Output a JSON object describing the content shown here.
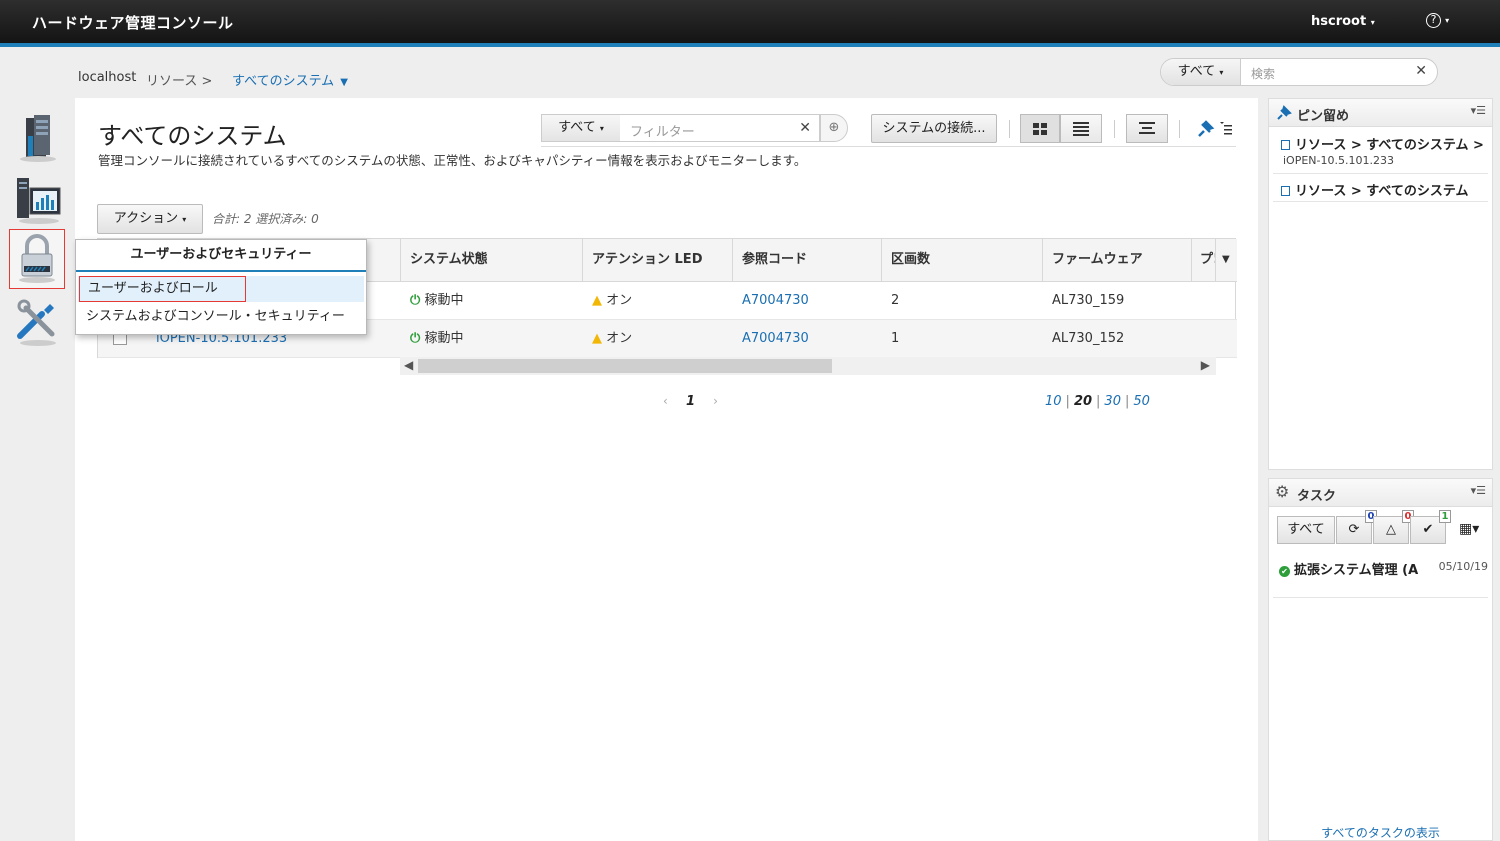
{
  "app": {
    "title": "ハードウェア管理コンソール",
    "user": "hscroot",
    "help": "?"
  },
  "breadcrumb": {
    "host": "localhost",
    "resources": "リソース >",
    "current": "すべてのシステム"
  },
  "global_search": {
    "scope": "すべて",
    "placeholder": "検索"
  },
  "page": {
    "title": "すべてのシステム",
    "description": "管理コンソールに接続されているすべてのシステムの状態、正常性、およびキャパシティー情報を表示およびモニターします。",
    "filter_scope": "すべて",
    "filter_placeholder": "フィルター",
    "connect_button": "システムの接続...",
    "actions_button": "アクション",
    "summary": "合計: 2 選択済み: 0"
  },
  "table": {
    "columns": [
      "システム状態",
      "アテンション LED",
      "参照コード",
      "区画数",
      "ファームウェア",
      "プ!"
    ],
    "rows": [
      {
        "name": "",
        "status": "稼動中",
        "led": "オン",
        "refcode": "A7004730",
        "partitions": "2",
        "firmware": "AL730_159"
      },
      {
        "name": "iOPEN-10.5.101.233",
        "status": "稼動中",
        "led": "オン",
        "refcode": "A7004730",
        "partitions": "1",
        "firmware": "AL730_152"
      }
    ]
  },
  "pager": {
    "prev": "‹",
    "page": "1",
    "next": "›",
    "sizes": [
      "10",
      "20",
      "30",
      "50"
    ],
    "current_size": "20"
  },
  "menu": {
    "header": "ユーザーおよびセキュリティー",
    "items": [
      "ユーザーおよびロール",
      "システムおよびコンソール・セキュリティー"
    ]
  },
  "pins": {
    "title": "ピン留め",
    "items": [
      {
        "label": "リソース > すべてのシステム > i",
        "sub": "iOPEN-10.5.101.233"
      },
      {
        "label": "リソース > すべてのシステム",
        "sub": ""
      }
    ]
  },
  "tasks": {
    "title": "タスク",
    "filter_all": "すべて",
    "badges": {
      "running": "0",
      "warning": "0",
      "done": "1"
    },
    "items": [
      {
        "name": "拡張システム管理 (A",
        "date": "05/10/19"
      }
    ],
    "view_all": "すべてのタスクの表示"
  },
  "colors": {
    "accent": "#1f7fb8",
    "link": "#1a6fb3",
    "highlight_border": "#e53935",
    "ok_green": "#2e9e3b",
    "warn_yellow": "#f2b705"
  },
  "icons": [
    "servers-icon",
    "system-chart-icon",
    "lock-icon",
    "tools-icon",
    "power-icon",
    "warning-icon",
    "pin-icon",
    "gear-icon",
    "refresh-icon",
    "check-icon"
  ]
}
